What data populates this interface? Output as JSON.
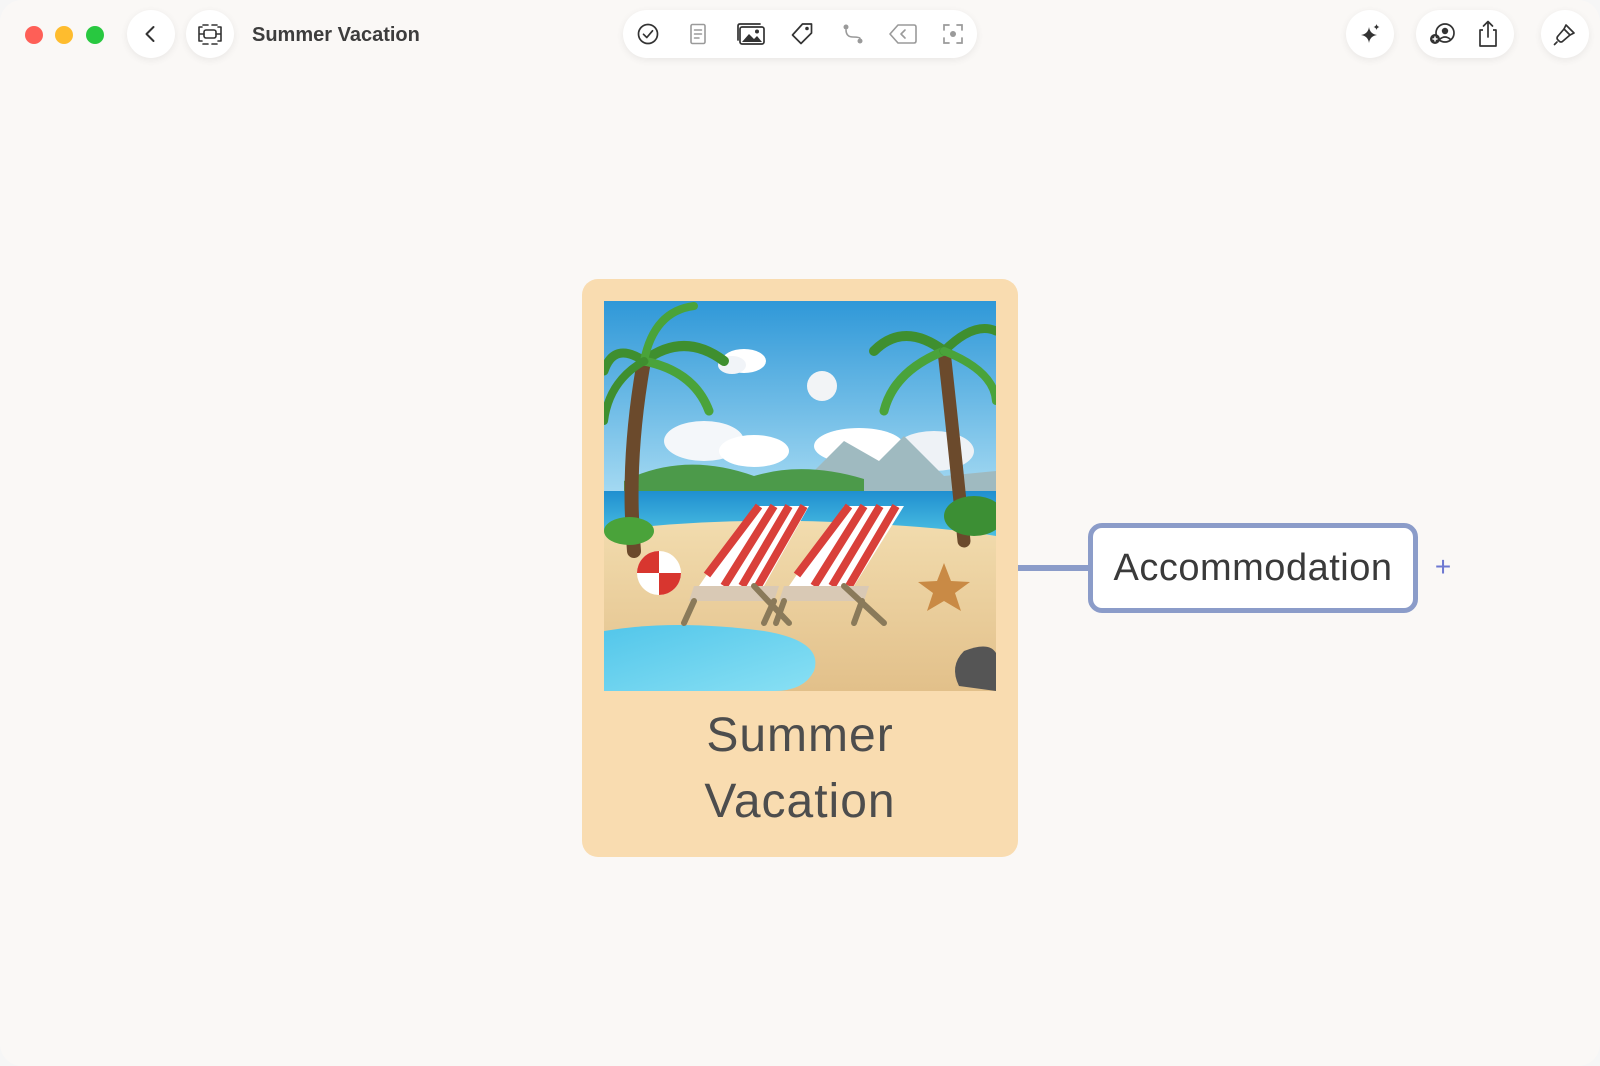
{
  "window": {
    "title": "Summer Vacation"
  },
  "titlebar": {
    "close_icon": "close-circle",
    "minimize_icon": "minimize-circle",
    "zoom_icon": "zoom-circle",
    "back_icon": "chevron-left-icon",
    "map_icon": "mindmap-icon"
  },
  "toolbar": {
    "icons": [
      "check-circle-icon",
      "note-icon",
      "image-icon",
      "tag-icon",
      "relationship-icon",
      "back-arrow-icon",
      "focus-icon"
    ]
  },
  "right_tools": {
    "icons": [
      "ai-sparkle-icon",
      "collaborate-icon",
      "share-icon",
      "format-brush-icon"
    ]
  },
  "canvas": {
    "central_topic": {
      "text": "Summer Vacation",
      "background": "#f9dcb0",
      "image": "beach scene with palm trees and striped lounge chairs"
    },
    "subtopic": {
      "text": "Accommodation",
      "border_color": "#8b9cc9"
    },
    "add_symbol": "+"
  }
}
